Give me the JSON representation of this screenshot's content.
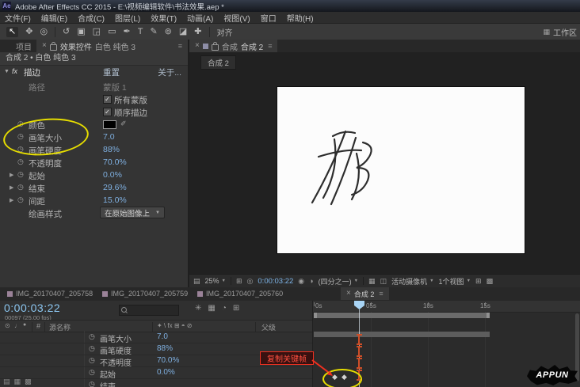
{
  "window": {
    "title": "Adobe After Effects CC 2015 - E:\\视频编辑软件\\书法效果.aep *"
  },
  "menu": {
    "items": [
      "文件(F)",
      "编辑(E)",
      "合成(C)",
      "图层(L)",
      "效果(T)",
      "动画(A)",
      "视图(V)",
      "窗口",
      "帮助(H)"
    ]
  },
  "toolbar": {
    "align": "对齐",
    "workspace": "工作区"
  },
  "icons": {
    "ae_logo": "Ae",
    "close": "×",
    "panel_menu": "≡",
    "check": "✓",
    "caret_down": "▼",
    "caret_right": "▶",
    "stopwatch": "◷",
    "diamond": "◆",
    "eyedropper": "✐",
    "tools": [
      "↖",
      "✥",
      "◎",
      "↺",
      "▣",
      "◲",
      "▭",
      "✒",
      "T",
      "✎",
      "⊚",
      "◪",
      "✚"
    ],
    "grid": "⊞",
    "target": "◎",
    "snapshot": "◉",
    "channels": "◑",
    "layout": "▦",
    "trans": "▩",
    "aspect": "◫",
    "zoom_fit": "▤",
    "star": "✳",
    "clock": "◔",
    "eye": "⊙",
    "note": "♩",
    "dot": "●",
    "toggle1": "▤",
    "toggle2": "▦",
    "toggle3": "▩",
    "workspace": "▦"
  },
  "effects_panel": {
    "tab_project": "项目",
    "tab_title": "效果控件",
    "tab_layer": "白色 纯色 3",
    "breadcrumb": "合成 2 • 白色 纯色 3",
    "fx_badge": "fx",
    "effect_name": "描边",
    "reset_label": "重置",
    "about_label": "关于...",
    "params": [
      {
        "label": "路径",
        "value": "蒙版 1"
      },
      {
        "label": "所有蒙版"
      },
      {
        "label": "顺序描边"
      },
      {
        "label": "颜色"
      },
      {
        "label": "画笔大小",
        "value": "7.0"
      },
      {
        "label": "画笔硬度",
        "value": "88%"
      },
      {
        "label": "不透明度",
        "value": "70.0%"
      },
      {
        "label": "起始",
        "value": "0.0%"
      },
      {
        "label": "结束",
        "value": "29.6%"
      },
      {
        "label": "间距",
        "value": "15.0%"
      },
      {
        "label": "绘画样式",
        "value": "在原始图像上"
      }
    ]
  },
  "comp_panel": {
    "tab_panel_label": "合成",
    "tab_comp_name": "合成 2",
    "nav_badge": "合成 2",
    "footer": {
      "zoom": "25%",
      "time": "0:00:03:22",
      "resolution": "(四分之一)",
      "camera": "活动摄像机",
      "views": "1个视图"
    }
  },
  "timeline": {
    "tabs": [
      "IMG_20170407_205758",
      "IMG_20170407_205759",
      "IMG_20170407_205760"
    ],
    "active_tab": "合成 2",
    "time_display": "0:00:03:22",
    "frame_info": "00097 (25.00 fps)",
    "col_hash": "#",
    "col_source": "源名称",
    "col_switches": "✦ \\ fx ⊞ ◓ ⊘",
    "col_parent": "父级",
    "props": [
      {
        "label": "画笔大小",
        "value": "7.0"
      },
      {
        "label": "画笔硬度",
        "value": "88%"
      },
      {
        "label": "不透明度",
        "value": "70.0%"
      },
      {
        "label": "起始",
        "value": "0.0%"
      },
      {
        "label": "结束",
        "value": ""
      }
    ],
    "ruler": [
      "0s",
      "05s",
      "10s",
      "15s"
    ],
    "annotation": "复制关键帧"
  },
  "watermark": "APPUN",
  "colors": {
    "value_blue": "#7eaede",
    "time_blue": "#8cc6f0",
    "annotation_yellow": "#e6dd00",
    "annotation_red": "#f03020",
    "playhead_blue": "#a8d4f5",
    "keyframe_orange": "#cf4f28"
  }
}
